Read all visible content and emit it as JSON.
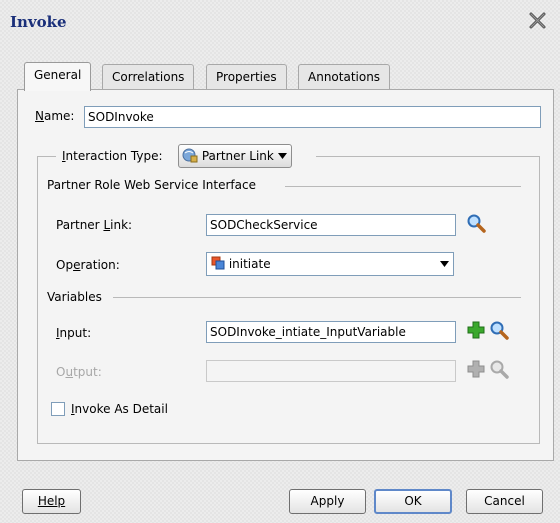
{
  "dialog": {
    "title": "Invoke"
  },
  "tabs": [
    {
      "label": "General",
      "active": true
    },
    {
      "label": "Correlations",
      "active": false
    },
    {
      "label": "Properties",
      "active": false
    },
    {
      "label": "Annotations",
      "active": false
    }
  ],
  "general": {
    "name_label": "Name:",
    "name_value": "SODInvoke",
    "interaction_type_label": "Interaction Type:",
    "interaction_type_value": "Partner Link",
    "partner_section_title": "Partner Role Web Service Interface",
    "partner_link_label": "Partner Link:",
    "partner_link_value": "SODCheckService",
    "operation_label": "Operation:",
    "operation_value": "initiate",
    "variables_section_title": "Variables",
    "input_label": "Input:",
    "input_value": "SODInvoke_intiate_InputVariable",
    "output_label": "Output:",
    "output_value": "",
    "invoke_as_detail_label": "Invoke As Detail",
    "invoke_as_detail_checked": false
  },
  "buttons": {
    "help": "Help",
    "apply": "Apply",
    "ok": "OK",
    "cancel": "Cancel"
  },
  "icons": {
    "close": "close-x-icon",
    "search": "magnifier-icon",
    "add": "plus-icon",
    "partner_link": "partner-link-icon",
    "operation": "operation-icon",
    "dropdown": "triangle-down-icon"
  },
  "colors": {
    "title": "#1a2f7a",
    "add_icon": "#2e9a22",
    "default_button_border": "#5f88c9"
  }
}
